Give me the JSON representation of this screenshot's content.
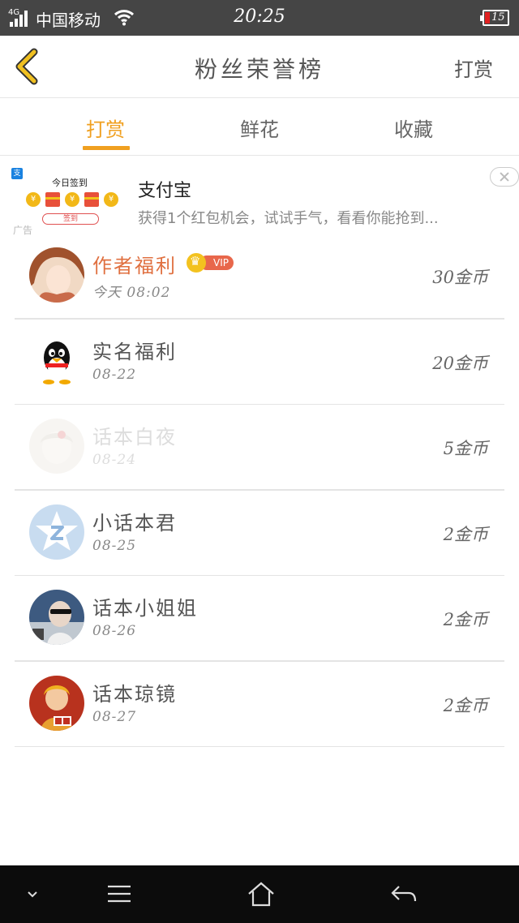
{
  "status_bar": {
    "network": "4G",
    "carrier": "中国移动",
    "time": "20:25",
    "battery": "15",
    "battery_color": "#e02020"
  },
  "header": {
    "title": "粉丝荣誉榜",
    "action": "打赏",
    "back_icon": "chevron-left-icon",
    "accent": "#f0a020"
  },
  "tabs": [
    {
      "label": "打赏",
      "active": true
    },
    {
      "label": "鲜花",
      "active": false
    },
    {
      "label": "收藏",
      "active": false
    }
  ],
  "ad": {
    "thumb_checkin": "今日签到",
    "thumb_button": "签到",
    "tag": "广告",
    "title": "支付宝",
    "description": "获得1个红包机会，试试手气，看看你能抢到..."
  },
  "fans": [
    {
      "name": "作者福利",
      "date": "今天 08:02",
      "amount": "30金币",
      "vip": "VIP",
      "highlight": true,
      "faded": false
    },
    {
      "name": "实名福利",
      "date": "08-22",
      "amount": "20金币",
      "highlight": false,
      "faded": false
    },
    {
      "name": "话本白夜",
      "date": "08-24",
      "amount": "5金币",
      "highlight": false,
      "faded": true
    },
    {
      "name": "小话本君",
      "date": "08-25",
      "amount": "2金币",
      "highlight": false,
      "faded": false
    },
    {
      "name": "话本小姐姐",
      "date": "08-26",
      "amount": "2金币",
      "highlight": false,
      "faded": false
    },
    {
      "name": "话本琼镜",
      "date": "08-27",
      "amount": "2金币",
      "highlight": false,
      "faded": false
    }
  ],
  "navbar": {
    "icons": [
      "chevron-down-icon",
      "menu-icon",
      "home-icon",
      "back-arrow-icon"
    ]
  }
}
